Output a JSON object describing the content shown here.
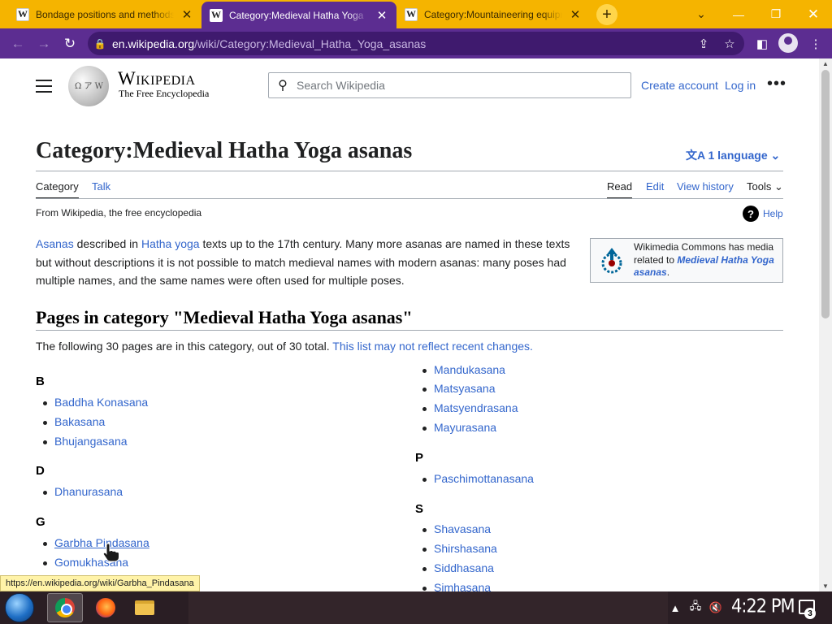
{
  "browser": {
    "tabs": [
      {
        "title": "Bondage positions and methods",
        "favicon": "W",
        "active": false
      },
      {
        "title": "Category:Medieval Hatha Yoga",
        "favicon": "W",
        "active": true
      },
      {
        "title": "Category:Mountaineering equipment",
        "favicon": "W",
        "active": false
      }
    ],
    "new_tab_label": "+",
    "url_host": "en.wikipedia.org",
    "url_path": "/wiki/Category:Medieval_Hatha_Yoga_asanas",
    "accent": "#5c2d91",
    "tabstrip_color": "#f5b400"
  },
  "wiki": {
    "wordmark": "Wikipedia",
    "tagline": "The Free Encyclopedia",
    "search_placeholder": "Search Wikipedia",
    "create_account": "Create account",
    "log_in": "Log in",
    "title": "Category:Medieval Hatha Yoga asanas",
    "language_button": "1 language",
    "tabs": {
      "category": "Category",
      "talk": "Talk",
      "read": "Read",
      "edit": "Edit",
      "history": "View history",
      "tools": "Tools"
    },
    "from_wikipedia": "From Wikipedia, the free encyclopedia",
    "help": "Help",
    "intro": {
      "link1": "Asanas",
      "t1": " described in ",
      "link2": "Hatha yoga",
      "t2": " texts up to the 17th century. Many more asanas are named in these texts but without descriptions it is not possible to match medieval names with modern asanas: many poses had multiple names, and the same names were often used for multiple poses."
    },
    "commons": {
      "text": "Wikimedia Commons has media related to ",
      "link": "Medieval Hatha Yoga asanas",
      "end": "."
    },
    "section_heading": "Pages in category \"Medieval Hatha Yoga asanas\"",
    "following_text": "The following 30 pages are in this category, out of 30 total. ",
    "following_link": "This list may not reflect recent changes.",
    "groups_left": [
      {
        "letter": "B",
        "items": [
          "Baddha Konasana",
          "Bakasana",
          "Bhujangasana"
        ]
      },
      {
        "letter": "D",
        "items": [
          "Dhanurasana"
        ]
      },
      {
        "letter": "G",
        "items": [
          "Garbha Pindasana",
          "Gomukhasana"
        ]
      }
    ],
    "cont_items": [
      "Mandukasana",
      "Matsyasana",
      "Matsyendrasana",
      "Mayurasana"
    ],
    "groups_right": [
      {
        "letter": "P",
        "items": [
          "Paschimottanasana"
        ]
      },
      {
        "letter": "S",
        "items": [
          "Shavasana",
          "Shirshasana",
          "Siddhasana",
          "Simhasana"
        ]
      }
    ],
    "status_url": "https://en.wikipedia.org/wiki/Garbha_Pindasana",
    "link_color": "#3366cc"
  },
  "taskbar": {
    "clock": "4:22 PM",
    "notification_count": "3",
    "apps": [
      "chrome-icon",
      "firefox-icon",
      "folder-icon"
    ]
  }
}
